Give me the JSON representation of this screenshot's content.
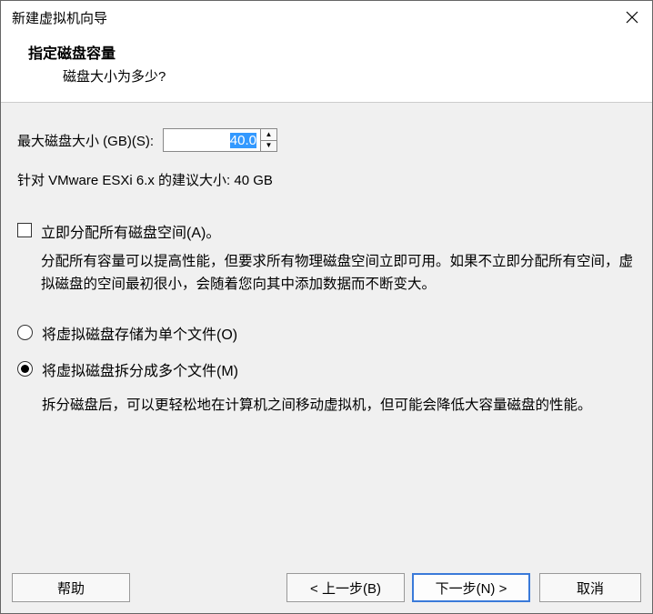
{
  "window": {
    "title": "新建虚拟机向导"
  },
  "header": {
    "title": "指定磁盘容量",
    "subtitle": "磁盘大小为多少?"
  },
  "disk": {
    "label": "最大磁盘大小 (GB)(S):",
    "value": "40.0",
    "recommend_prefix": "针对 ",
    "recommend_product": "VMware ESXi 6.x",
    "recommend_suffix": " 的建议大小: 40 GB"
  },
  "allocate": {
    "label": "立即分配所有磁盘空间(A)。",
    "desc": "分配所有容量可以提高性能，但要求所有物理磁盘空间立即可用。如果不立即分配所有空间，虚拟磁盘的空间最初很小，会随着您向其中添加数据而不断变大。"
  },
  "radios": {
    "single": "将虚拟磁盘存储为单个文件(O)",
    "split": "将虚拟磁盘拆分成多个文件(M)",
    "split_desc": "拆分磁盘后，可以更轻松地在计算机之间移动虚拟机，但可能会降低大容量磁盘的性能。"
  },
  "footer": {
    "help": "帮助",
    "back": "< 上一步(B)",
    "next": "下一步(N) >",
    "cancel": "取消"
  }
}
